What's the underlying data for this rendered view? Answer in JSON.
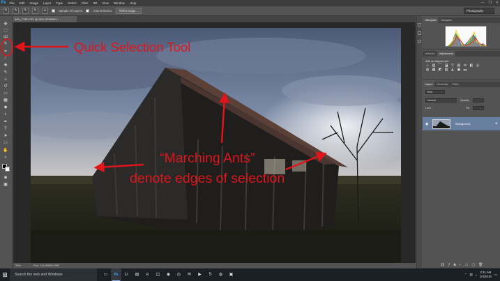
{
  "menubar": {
    "logo": "Ps",
    "items": [
      "File",
      "Edit",
      "Image",
      "Layer",
      "Type",
      "Select",
      "Filter",
      "3D",
      "View",
      "Window",
      "Help"
    ],
    "window_controls": [
      "—",
      "❐",
      "✕"
    ]
  },
  "options_bar": {
    "sample_all_layers": "Sample All Layers",
    "auto_enhance": "Auto-Enhance",
    "refine_edge": "Refine Edge...",
    "workspace": "Photography"
  },
  "document": {
    "tab_title": "IMG_7155.CR2 @ 25% (RGB/8#) *",
    "zoom": "25%",
    "doc_size": "Doc: 114.0M/114.0M"
  },
  "panels": {
    "histogram_tabs": [
      "Histogram",
      "Navigator"
    ],
    "adjust_tabs": [
      "Libraries",
      "Adjustments"
    ],
    "adjust_label": "Add an adjustment",
    "layers_tabs": [
      "Layers",
      "Channels",
      "Paths"
    ],
    "kind": "Kind",
    "blend_mode": "Normal",
    "opacity_label": "Opacity:",
    "lock_label": "Lock:",
    "fill_label": "Fill:",
    "layer_name": "Background"
  },
  "annotations": {
    "quick_selection": "Quick Selection Tool",
    "marching_line1": "“Marching Ants”",
    "marching_line2": "denote edges of selection",
    "color": "#e0151b"
  },
  "taskbar": {
    "search_placeholder": "Search the web and Windows",
    "time": "2:11 AM",
    "date": "2/4/2016"
  }
}
